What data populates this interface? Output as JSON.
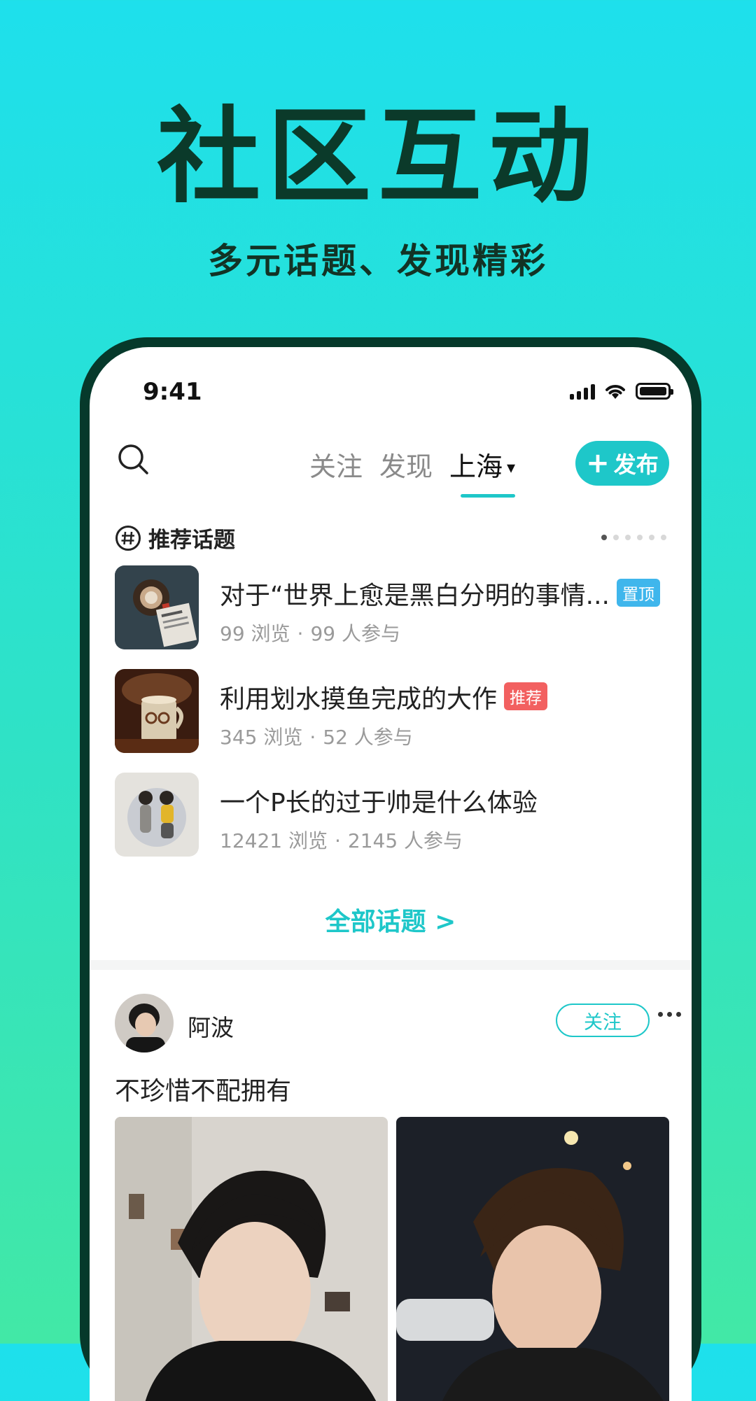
{
  "promo": {
    "title": "社区互动",
    "subtitle": "多元话题、发现精彩"
  },
  "status_bar": {
    "time": "9:41"
  },
  "nav": {
    "tabs": [
      {
        "label": "关注"
      },
      {
        "label": "发现"
      },
      {
        "label": "上海",
        "active": true,
        "caret": "▾"
      }
    ],
    "publish_label": "发布",
    "publish_plus": "+"
  },
  "section": {
    "title": "推荐话题",
    "pager": {
      "count": 6,
      "active": 1
    }
  },
  "topics": [
    {
      "title": "对于“世界上愈是黑白分明的事情...",
      "badge": "置顶",
      "badge_color": "#3fb6ec",
      "views": "99 浏览",
      "participants": "99 人参与"
    },
    {
      "title": "利用划水摸鱼完成的大作",
      "badge": "推荐",
      "badge_color": "#f26060",
      "views": "345 浏览",
      "participants": "52 人参与"
    },
    {
      "title": "一个P长的过于帅是什么体验",
      "badge": "",
      "views": "12421 浏览",
      "participants": "2145 人参与"
    }
  ],
  "stats_separator": "·",
  "all_topics": "全部话题 >",
  "post": {
    "username": "阿波",
    "follow_label": "关注",
    "text": "不珍惜不配拥有"
  },
  "colors": {
    "accent": "#1ec7c9",
    "phone_frame": "#06392b",
    "title": "#0b3a2a"
  }
}
